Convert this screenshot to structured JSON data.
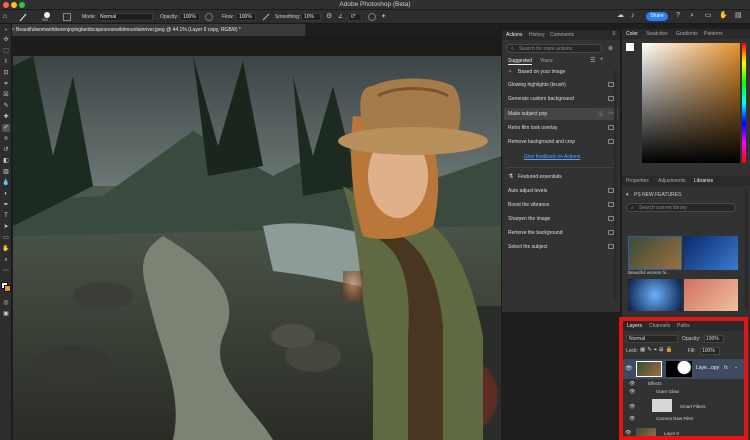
{
  "app": {
    "title": "Adobe Photoshop (Beta)"
  },
  "options_bar": {
    "size": "300",
    "mode_label": "Mode:",
    "mode_value": "Normal",
    "opacity_label": "Opacity:",
    "opacity_value": "100%",
    "flow_label": "Flow:",
    "flow_value": "100%",
    "smoothing_label": "Smoothing:",
    "smoothing_value": "10%",
    "angle_value": "0°",
    "share_label": "Share"
  },
  "document": {
    "tab_title": "Beautifulwomanhikerenjoyinglandscapesrearwildmountainriver.jpeg @ 44.1% (Layer 0 copy, RGB/8) *"
  },
  "actions_panel": {
    "tabs": [
      "Actions",
      "History",
      "Comments"
    ],
    "search_placeholder": "Search for more actions",
    "subtabs": {
      "suggested": "Suggested",
      "yours": "Yours"
    },
    "based_on": "Based on your image",
    "suggested_items": [
      "Glowing highlights (brush)",
      "Generate custom background",
      "Make subject pop",
      "Retro film look overlay",
      "Remove background and crop"
    ],
    "feedback": "Give feedback on Actions",
    "featured_title": "Featured essentials",
    "featured_items": [
      "Auto adjust levels",
      "Boost the vibrance",
      "Sharpen the image",
      "Remove the background",
      "Select the subject"
    ]
  },
  "color_panel": {
    "tabs": [
      "Color",
      "Swatches",
      "Gradients",
      "Patterns"
    ],
    "base_hue": "#e6922e"
  },
  "libraries_panel": {
    "tabs": [
      "Properties",
      "Adjustments",
      "Libraries"
    ],
    "library_name": "PS NEW FEATURES",
    "search_placeholder": "Search current library",
    "item_label": "Beautiful woman hi..."
  },
  "layers_panel": {
    "tabs": [
      "Layers",
      "Channels",
      "Paths"
    ],
    "blend_mode": "Normal",
    "opacity_label": "Opacity:",
    "opacity_value": "100%",
    "lock_label": "Lock:",
    "fill_label": "Fill:",
    "fill_value": "100%",
    "layers": [
      {
        "name": "Laye...opy",
        "selected": true
      },
      {
        "name": "Effects",
        "selected": false
      },
      {
        "name": "Outer Glow",
        "selected": false
      },
      {
        "name": "Smart Filters",
        "selected": false
      },
      {
        "name": "Camera Raw Filter",
        "selected": false
      },
      {
        "name": "Layer 0",
        "selected": false
      }
    ]
  },
  "colors": {
    "accent": "#2d7ff9",
    "highlight": "#e21414",
    "panel": "#323232"
  }
}
